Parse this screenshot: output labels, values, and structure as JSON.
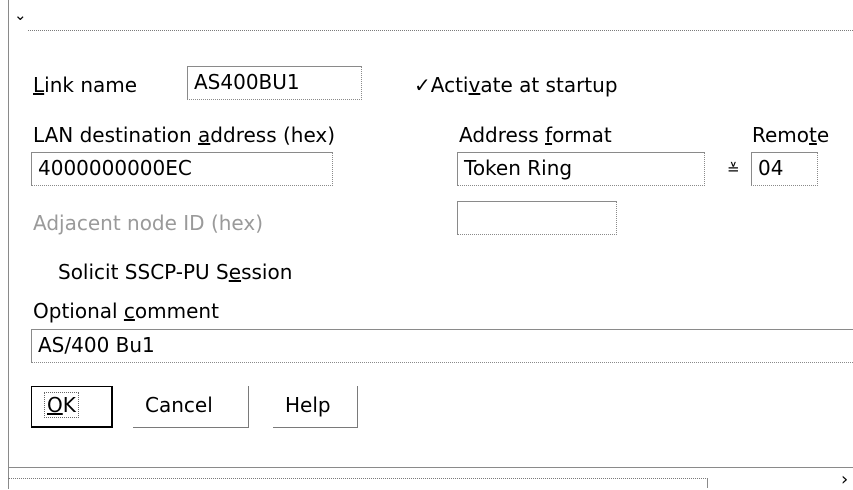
{
  "window": {
    "collapse_glyph": "⌄",
    "scroll_right_glyph": "›"
  },
  "link": {
    "label_mnemonic": "L",
    "label_rest": "ink name",
    "value": "AS400BU1",
    "activate_check": "✓",
    "activate_pre": "Acti",
    "activate_mnemonic": "v",
    "activate_post": "ate at startup"
  },
  "lan": {
    "label_pre": "LAN destination ",
    "label_mnemonic": "a",
    "label_post": "ddress  (hex)",
    "value": "4000000000EC"
  },
  "address_format": {
    "label_pre": "Address ",
    "label_mnemonic": "f",
    "label_post": "ormat",
    "value": "Token Ring",
    "dropdown_glyph": "≚"
  },
  "remote": {
    "label_pre": "Remo",
    "label_mnemonic": "t",
    "label_post": "e",
    "value": "04"
  },
  "adjacent": {
    "label": "Adjacent node ID  (hex)",
    "value": ""
  },
  "solicit": {
    "label_pre": "Solicit SSCP-PU S",
    "label_mnemonic": "e",
    "label_post": "ssion"
  },
  "comment": {
    "label_pre": "Optional ",
    "label_mnemonic": "c",
    "label_post": "omment",
    "value": "AS/400 Bu1"
  },
  "buttons": {
    "ok_mnemonic": "O",
    "ok_rest": "K",
    "cancel": "Cancel",
    "help": "Help"
  },
  "colors": {
    "border": "#8a8a8a",
    "disabled_text": "#9a9a9a"
  }
}
